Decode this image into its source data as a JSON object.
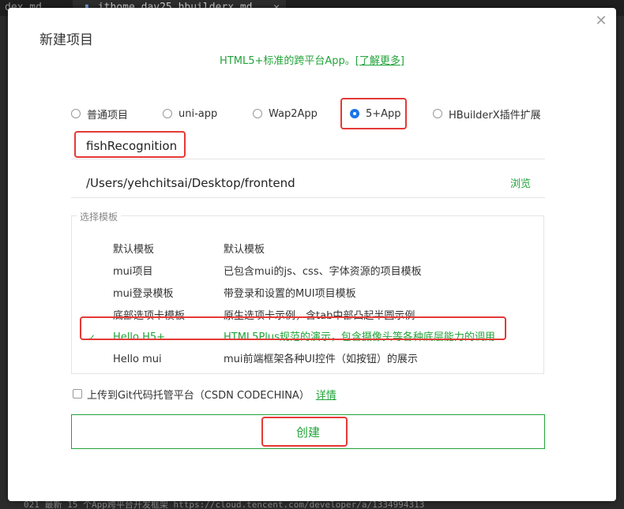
{
  "background": {
    "tab_left": "dex.md",
    "tab_active": "ithome_day25_hbuilderx.md",
    "tab_active_close": "✕",
    "bottom_line": "021  最新  15  个App跨平台开发框架  https://cloud.tencent.com/developer/a/1334994313"
  },
  "dialog": {
    "title": "新建项目",
    "close_symbol": "✕",
    "subtitle": "HTML5+标准的跨平台App。",
    "subtitle_link": "[了解更多]"
  },
  "project_types": [
    {
      "label": "普通项目",
      "checked": false
    },
    {
      "label": "uni-app",
      "checked": false
    },
    {
      "label": "Wap2App",
      "checked": false
    },
    {
      "label": "5+App",
      "checked": true
    },
    {
      "label": "HBuilderX插件扩展",
      "checked": false
    }
  ],
  "project_name": "fishRecognition",
  "project_path": "/Users/yehchitsai/Desktop/frontend",
  "browse_label": "浏览",
  "template_section": {
    "legend": "选择模板",
    "check_symbol": "✓",
    "templates": [
      {
        "name": "默认模板",
        "desc": "默认模板",
        "selected": false
      },
      {
        "name": "mui项目",
        "desc": "已包含mui的js、css、字体资源的项目模板",
        "selected": false
      },
      {
        "name": "mui登录模板",
        "desc": "带登录和设置的MUI项目模板",
        "selected": false
      },
      {
        "name": "底部选项卡模板",
        "desc": "原生选项卡示例，含tab中部凸起半圆示例",
        "selected": false
      },
      {
        "name": "Hello H5+",
        "desc": "HTML5Plus规范的演示，包含摄像头等各种底层能力的调用",
        "selected": true
      },
      {
        "name": "Hello mui",
        "desc": "mui前端框架各种UI控件（如按钮）的展示",
        "selected": false
      }
    ]
  },
  "git": {
    "label": "上传到Git代码托管平台（CSDN CODECHINA）",
    "link": "详情"
  },
  "create_label": "创建",
  "colors": {
    "accent_green": "#22a33a",
    "radio_blue": "#1a73e8",
    "highlight_red": "#e53935"
  }
}
